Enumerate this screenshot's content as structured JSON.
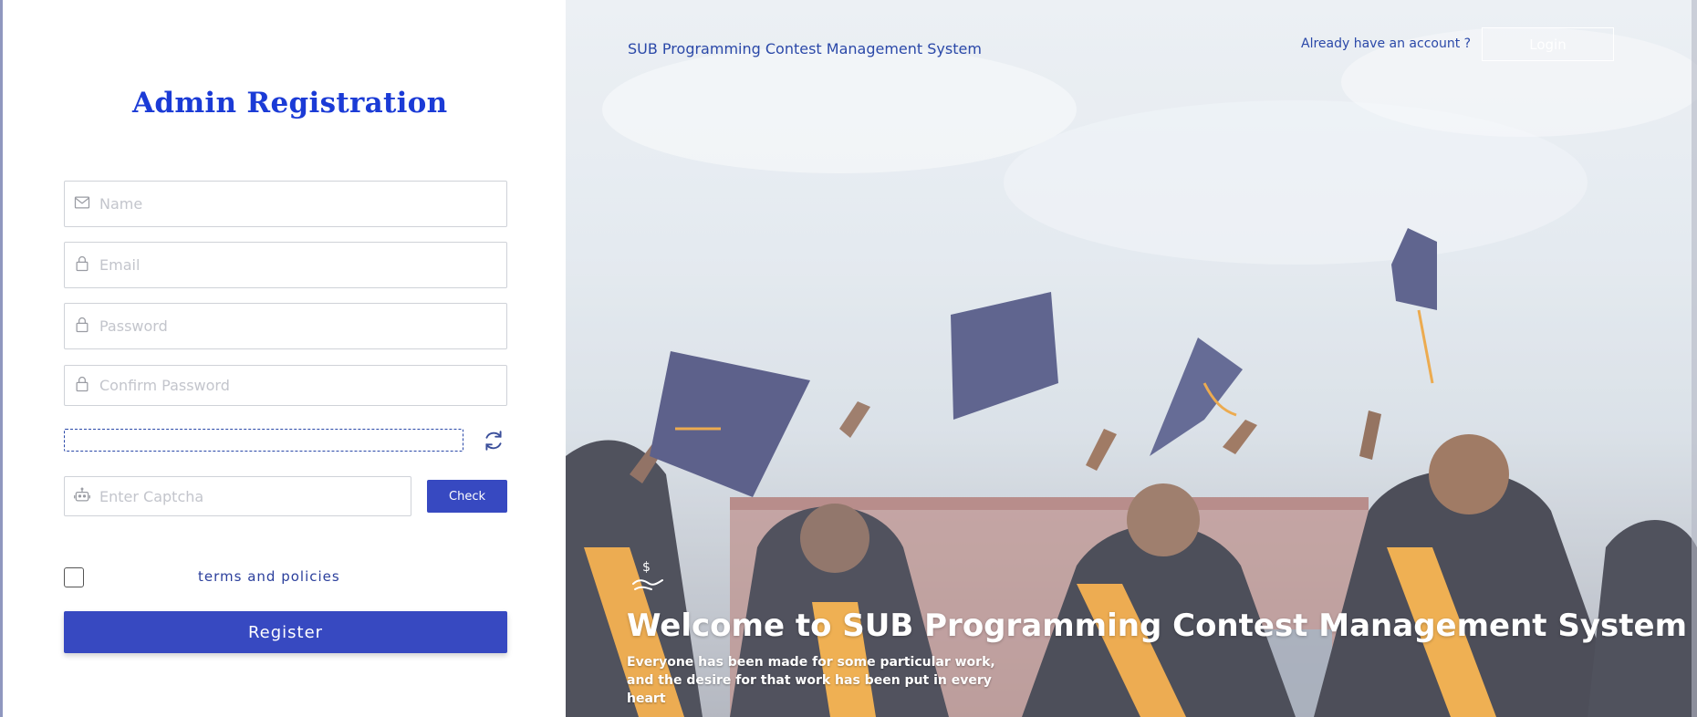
{
  "registration": {
    "title": "Admin Registration",
    "name_placeholder": "Name",
    "email_placeholder": "Email",
    "password_placeholder": "Password",
    "confirm_password_placeholder": "Confirm Password",
    "captcha_placeholder": "Enter Captcha",
    "check_label": "Check",
    "terms_label": "terms and policies",
    "register_label": "Register",
    "icons": {
      "name": "mail-icon",
      "email": "lock-icon",
      "password": "lock-icon",
      "confirm": "lock-icon",
      "captcha": "robot-icon",
      "refresh": "refresh-icon"
    }
  },
  "hero": {
    "brand": "SUB Programming Contest Management System",
    "already_account": "Already have an account ?",
    "login_label": "Login",
    "welcome": "Welcome to SUB Programming Contest Management System",
    "tagline": "Everyone has been made for some particular work, and the desire for that work has been put in every heart",
    "icon": "money-hand-icon"
  },
  "colors": {
    "accent": "#3749c1",
    "title": "#1b3bd6",
    "link": "#2a48a8"
  }
}
